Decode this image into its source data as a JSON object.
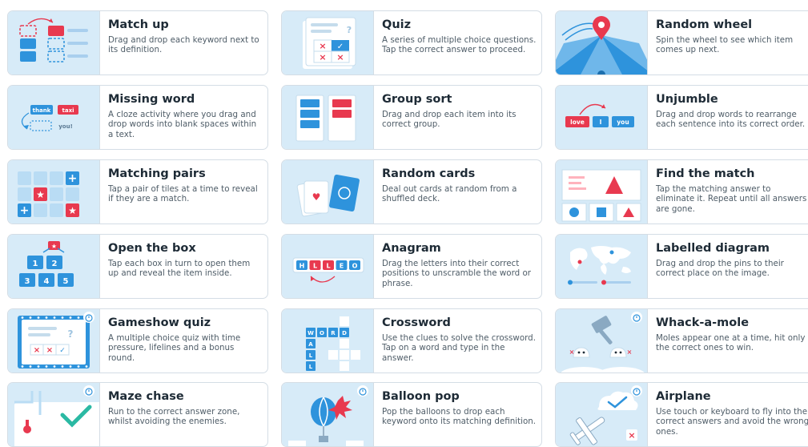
{
  "colors": {
    "thumb_bg": "#d7ebf8",
    "blue": "#2e93dc",
    "red": "#e8394f",
    "title": "#1e2b36",
    "desc": "#4f5d68",
    "border": "#d4dde5"
  },
  "templates": [
    {
      "title": "Match up",
      "description": "Drag and drop each keyword next to its definition.",
      "icon": "match-up-icon"
    },
    {
      "title": "Quiz",
      "description": "A series of multiple choice questions. Tap the correct answer to proceed.",
      "icon": "quiz-icon"
    },
    {
      "title": "Random wheel",
      "description": "Spin the wheel to see which item comes up next.",
      "icon": "random-wheel-icon"
    },
    {
      "title": "Missing word",
      "description": "A cloze activity where you drag and drop words into blank spaces within a text.",
      "icon": "missing-word-icon",
      "labels": [
        "thank",
        "taxi",
        "you!"
      ]
    },
    {
      "title": "Group sort",
      "description": "Drag and drop each item into its correct group.",
      "icon": "group-sort-icon"
    },
    {
      "title": "Unjumble",
      "description": "Drag and drop words to rearrange each sentence into its correct order.",
      "icon": "unjumble-icon",
      "labels": [
        "love",
        "I",
        "you"
      ]
    },
    {
      "title": "Matching pairs",
      "description": "Tap a pair of tiles at a time to reveal if they are a match.",
      "icon": "matching-pairs-icon"
    },
    {
      "title": "Random cards",
      "description": "Deal out cards at random from a shuffled deck.",
      "icon": "random-cards-icon"
    },
    {
      "title": "Find the match",
      "description": "Tap the matching answer to eliminate it. Repeat until all answers are gone.",
      "icon": "find-the-match-icon"
    },
    {
      "title": "Open the box",
      "description": "Tap each box in turn to open them up and reveal the item inside.",
      "icon": "open-the-box-icon",
      "labels": [
        "1",
        "2",
        "3",
        "4",
        "5"
      ]
    },
    {
      "title": "Anagram",
      "description": "Drag the letters into their correct positions to unscramble the word or phrase.",
      "icon": "anagram-icon",
      "labels": [
        "H",
        "L",
        "L",
        "E",
        "O"
      ]
    },
    {
      "title": "Labelled diagram",
      "description": "Drag and drop the pins to their correct place on the image.",
      "icon": "labelled-diagram-icon"
    },
    {
      "title": "Gameshow quiz",
      "description": "A multiple choice quiz with time pressure, lifelines and a bonus round.",
      "icon": "gameshow-quiz-icon",
      "badge": true
    },
    {
      "title": "Crossword",
      "description": "Use the clues to solve the crossword. Tap on a word and type in the answer.",
      "icon": "crossword-icon",
      "labels": [
        "W",
        "O",
        "R",
        "D",
        "A",
        "L",
        "L"
      ]
    },
    {
      "title": "Whack-a-mole",
      "description": "Moles appear one at a time, hit only the correct ones to win.",
      "icon": "whack-a-mole-icon",
      "badge": true
    },
    {
      "title": "Maze chase",
      "description": "Run to the correct answer zone, whilst avoiding the enemies.",
      "icon": "maze-chase-icon",
      "badge": true
    },
    {
      "title": "Balloon pop",
      "description": "Pop the balloons to drop each keyword onto its matching definition.",
      "icon": "balloon-pop-icon",
      "badge": true
    },
    {
      "title": "Airplane",
      "description": "Use touch or keyboard to fly into the correct answers and avoid the wrong ones.",
      "icon": "airplane-icon",
      "badge": true
    }
  ]
}
